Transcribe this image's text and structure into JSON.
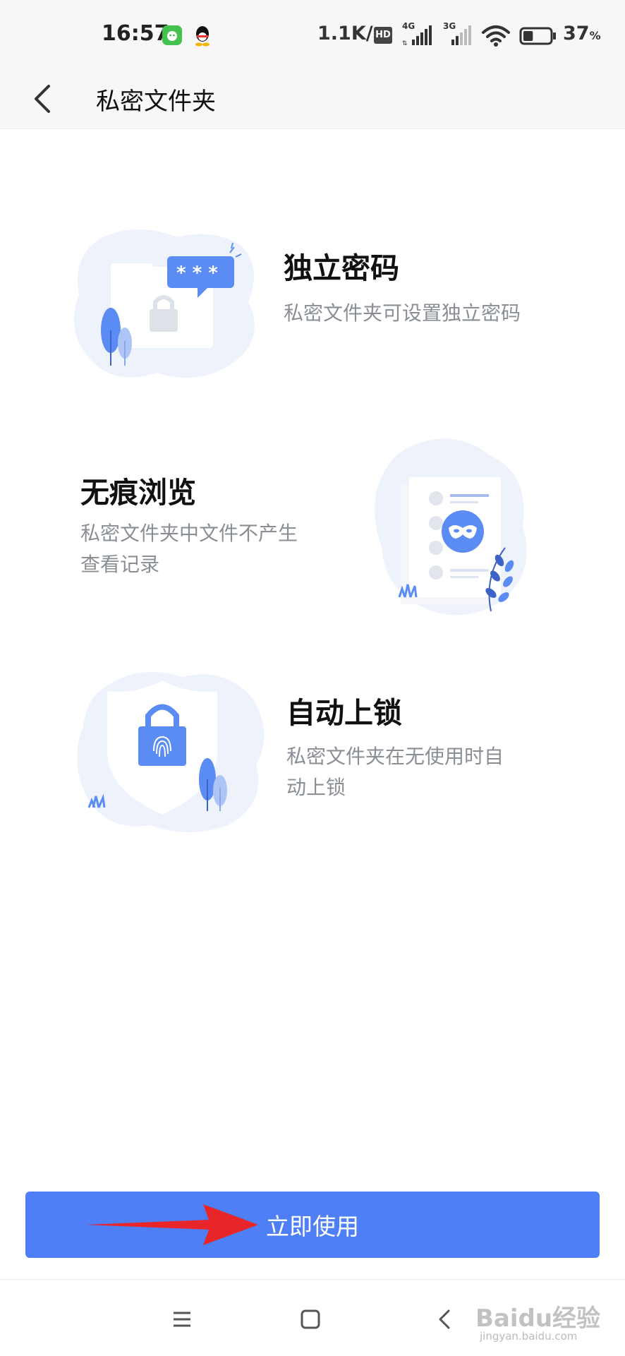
{
  "status_bar": {
    "time": "16:57",
    "net_speed": "1.1K/s",
    "hd_badge": "HD",
    "signal_1_label": "4G",
    "signal_2_label": "3G",
    "battery_value": "37",
    "battery_unit": "%",
    "battery_level": 0.37
  },
  "header": {
    "title": "私密文件夹",
    "back_icon": "chevron-left-icon"
  },
  "features": [
    {
      "title": "独立密码",
      "desc": [
        "私密文件夹可设置独立密码"
      ],
      "icon": "password-folder-illustration"
    },
    {
      "title": "无痕浏览",
      "desc": [
        "私密文件夹中文件不产生",
        "查看记录"
      ],
      "icon": "incognito-document-illustration"
    },
    {
      "title": "自动上锁",
      "desc": [
        "私密文件夹在无使用时自",
        "动上锁"
      ],
      "icon": "shield-lock-illustration"
    }
  ],
  "cta": {
    "label": "立即使用"
  },
  "nav": {
    "menu_icon": "menu-icon",
    "home_icon": "home-icon",
    "back_icon": "back-icon"
  },
  "watermark": {
    "brand": "Baidu经验",
    "url": "jingyan.baidu.com"
  },
  "colors": {
    "accent": "#4f7ff6",
    "title_text": "#111111",
    "desc_text": "#8a8f96",
    "illustration_bg": "#eef2fb",
    "annotation_arrow": "#e8262a"
  }
}
